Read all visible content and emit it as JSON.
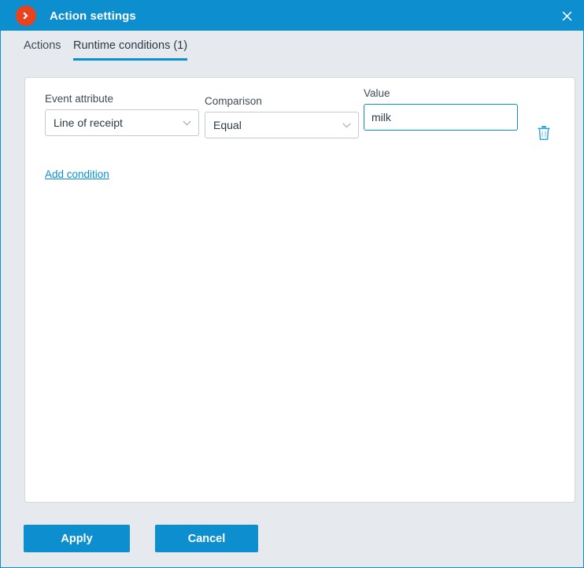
{
  "window": {
    "title": "Action settings",
    "logo_icon": "chevron-right-circle-icon",
    "close_icon": "close-icon",
    "accent_color": "#0d8ecf",
    "logo_color": "#e8431f",
    "background_color": "#e6eaee"
  },
  "tabs": [
    {
      "label": "Actions",
      "active": false
    },
    {
      "label": "Runtime conditions (1)",
      "active": true
    }
  ],
  "conditions_panel": {
    "columns": {
      "event_attribute_label": "Event attribute",
      "comparison_label": "Comparison",
      "value_label": "Value"
    },
    "rows": [
      {
        "event_attribute": "Line of receipt",
        "comparison": "Equal",
        "value": "milk",
        "value_placeholder": "",
        "value_focused": true,
        "delete_icon": "trash-icon",
        "dropdown_icon": "chevron-down-icon"
      }
    ],
    "add_condition_label": "Add condition"
  },
  "footer": {
    "apply_label": "Apply",
    "cancel_label": "Cancel"
  }
}
